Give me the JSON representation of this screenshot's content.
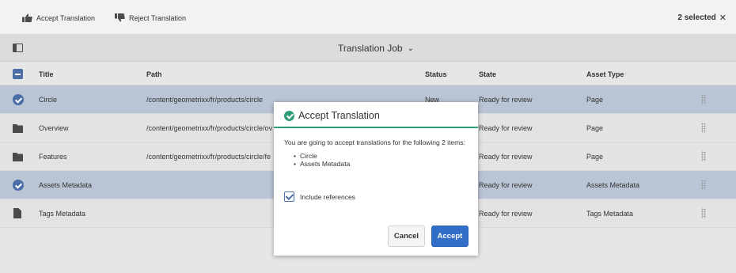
{
  "toolbar": {
    "accept_label": "Accept Translation",
    "reject_label": "Reject Translation",
    "selected_label": "2 selected",
    "close_glyph": "✕",
    "accept_icon": "thumbs-up-icon",
    "reject_icon": "thumbs-down-icon"
  },
  "titlebar": {
    "title": "Translation Job",
    "chevron": "⌄"
  },
  "table": {
    "headers": {
      "title": "Title",
      "path": "Path",
      "status": "Status",
      "state": "State",
      "asset_type": "Asset Type"
    },
    "rows": [
      {
        "title": "Circle",
        "path": "/content/geometrixx/fr/products/circle",
        "status": "New",
        "state": "Ready for review",
        "asset_type": "Page",
        "selected": true,
        "icon": "check-icon"
      },
      {
        "title": "Overview",
        "path": "/content/geometrixx/fr/products/circle/ov",
        "status": "",
        "state": "Ready for review",
        "asset_type": "Page",
        "selected": false,
        "icon": "folder-icon"
      },
      {
        "title": "Features",
        "path": "/content/geometrixx/fr/products/circle/fe",
        "status": "",
        "state": "Ready for review",
        "asset_type": "Page",
        "selected": false,
        "icon": "folder-icon"
      },
      {
        "title": "Assets Metadata",
        "path": "",
        "status": "",
        "state": "Ready for review",
        "asset_type": "Assets Metadata",
        "selected": true,
        "icon": "check-icon"
      },
      {
        "title": "Tags Metadata",
        "path": "",
        "status": "",
        "state": "Ready for review",
        "asset_type": "Tags Metadata",
        "selected": false,
        "icon": "file-icon"
      }
    ]
  },
  "dialog": {
    "title": "Accept Translation",
    "message": "You are going to accept translations for the following 2 items:",
    "items": [
      "Circle",
      "Assets Metadata"
    ],
    "checkbox_label": "Include references",
    "checkbox_checked": true,
    "cancel_label": "Cancel",
    "accept_label": "Accept"
  },
  "colors": {
    "accent": "#326ec8",
    "selected_row": "#b9c4d4",
    "success": "#2d9d78"
  }
}
